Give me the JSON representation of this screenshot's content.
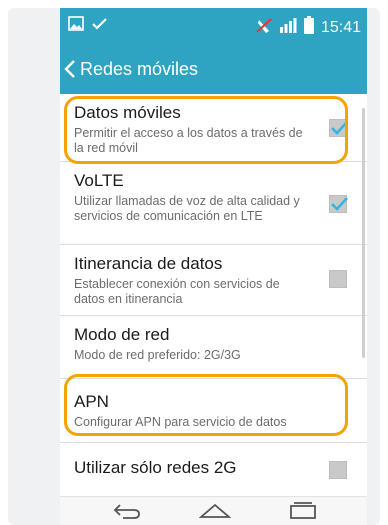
{
  "status_bar": {
    "time": "15:41",
    "icons": [
      "image-icon",
      "check-icon",
      "muted-vibrate-icon",
      "signal-icon",
      "battery-icon"
    ]
  },
  "header": {
    "title": "Redes móviles",
    "back_icon": "chevron-left-icon"
  },
  "settings": [
    {
      "title": "Datos móviles",
      "subtitle": "Permitir el acceso a los datos a través de la red móvil",
      "checked": true
    },
    {
      "title": "VoLTE",
      "subtitle": "Utilizar llamadas de voz de alta calidad y servicios de comunicación en LTE",
      "checked": true
    },
    {
      "title": "Itinerancia de datos",
      "subtitle": "Establecer conexión con servicios de datos en itinerancia",
      "checked": false
    },
    {
      "title": "Modo de red",
      "subtitle": "Modo de red preferido: 2G/3G"
    },
    {
      "title": "APN",
      "subtitle": "Configurar APN para servicio de datos"
    },
    {
      "title": "Utilizar sólo redes 2G",
      "checked": false
    }
  ],
  "nav_bar": {
    "icons": [
      "back-icon",
      "home-icon",
      "recents-icon"
    ]
  },
  "colors": {
    "accent": "#2ea3c2",
    "checkbox_tick": "#33b5e5",
    "highlight": "#f0a500"
  }
}
